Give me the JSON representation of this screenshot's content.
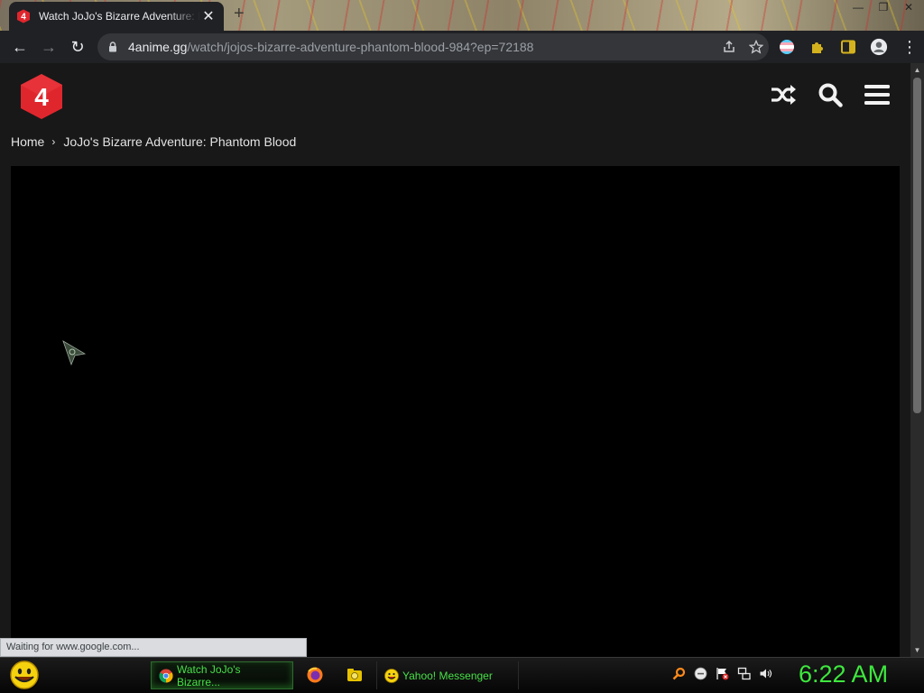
{
  "browser": {
    "tab": {
      "title": "Watch JoJo's Bizarre Adventure: Phantom Blood",
      "close_glyph": "✕"
    },
    "new_tab_glyph": "+",
    "window_controls": {
      "minimize": "—",
      "maximize": "❐",
      "close": "✕"
    },
    "nav": {
      "back_glyph": "←",
      "forward_glyph": "→",
      "reload_glyph": "↻"
    },
    "url": {
      "host": "4anime.gg",
      "path": "/watch/jojos-bizarre-adventure-phantom-blood-984?ep=72188"
    },
    "menu_glyph": "⋮",
    "status_text": "Waiting for www.google.com..."
  },
  "site": {
    "logo_text": "4",
    "breadcrumb": {
      "home": "Home",
      "separator": "›",
      "current": "JoJo's Bizarre Adventure: Phantom Blood"
    }
  },
  "taskbar": {
    "tasks": [
      {
        "label": "Watch JoJo's Bizarre..."
      },
      {
        "label": "Yahoo! Messenger"
      }
    ],
    "clock": "6:22 AM"
  },
  "colors": {
    "brand_red": "#e0262d",
    "page_bg": "#181818",
    "player_bg": "#000000",
    "taskbar_text": "#47e047",
    "clock": "#3ee83e"
  }
}
